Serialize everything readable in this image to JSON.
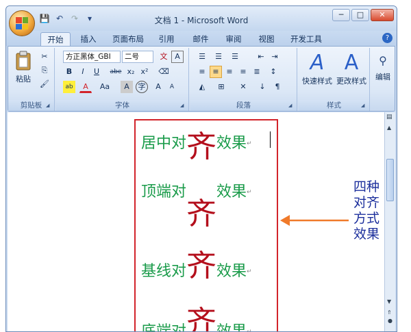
{
  "window": {
    "title": "文档 1 - Microsoft Word",
    "min": "─",
    "max": "□",
    "close": "✕"
  },
  "qat": {
    "save": "💾",
    "undo": "↶",
    "redo": "↷",
    "more": "▾"
  },
  "tabs": [
    "开始",
    "插入",
    "页面布局",
    "引用",
    "邮件",
    "审阅",
    "视图",
    "开发工具"
  ],
  "help": "?",
  "ribbon": {
    "clipboard": {
      "label": "剪贴板",
      "paste": "粘贴"
    },
    "font": {
      "label": "字体",
      "font_name": "方正黑体_GBI",
      "font_size": "二号",
      "buttons": [
        "B",
        "I",
        "U",
        "abe",
        "x₂",
        "x²",
        "A",
        "Aa",
        "A",
        "字",
        "A",
        "A"
      ]
    },
    "paragraph": {
      "label": "段落"
    },
    "styles": {
      "label": "样式",
      "quick": "快速样式",
      "change": "更改样式"
    },
    "editing": {
      "label": "编辑"
    }
  },
  "doc": {
    "lines": [
      {
        "pre": "居中对",
        "big": "齐",
        "post": "效果"
      },
      {
        "pre": "顶端对",
        "big": "齐",
        "post": "效果"
      },
      {
        "pre": "基线对",
        "big": "齐",
        "post": "效果"
      },
      {
        "pre": "底端对",
        "big": "齐",
        "post": "效果"
      }
    ],
    "note": [
      "四种",
      "对齐",
      "方式",
      "效果"
    ]
  },
  "colors": {
    "green": "#1a9b4a",
    "red": "#b40f1c",
    "frame": "#d2232a",
    "blue": "#1c2f9c",
    "arrow": "#f07a2a"
  }
}
